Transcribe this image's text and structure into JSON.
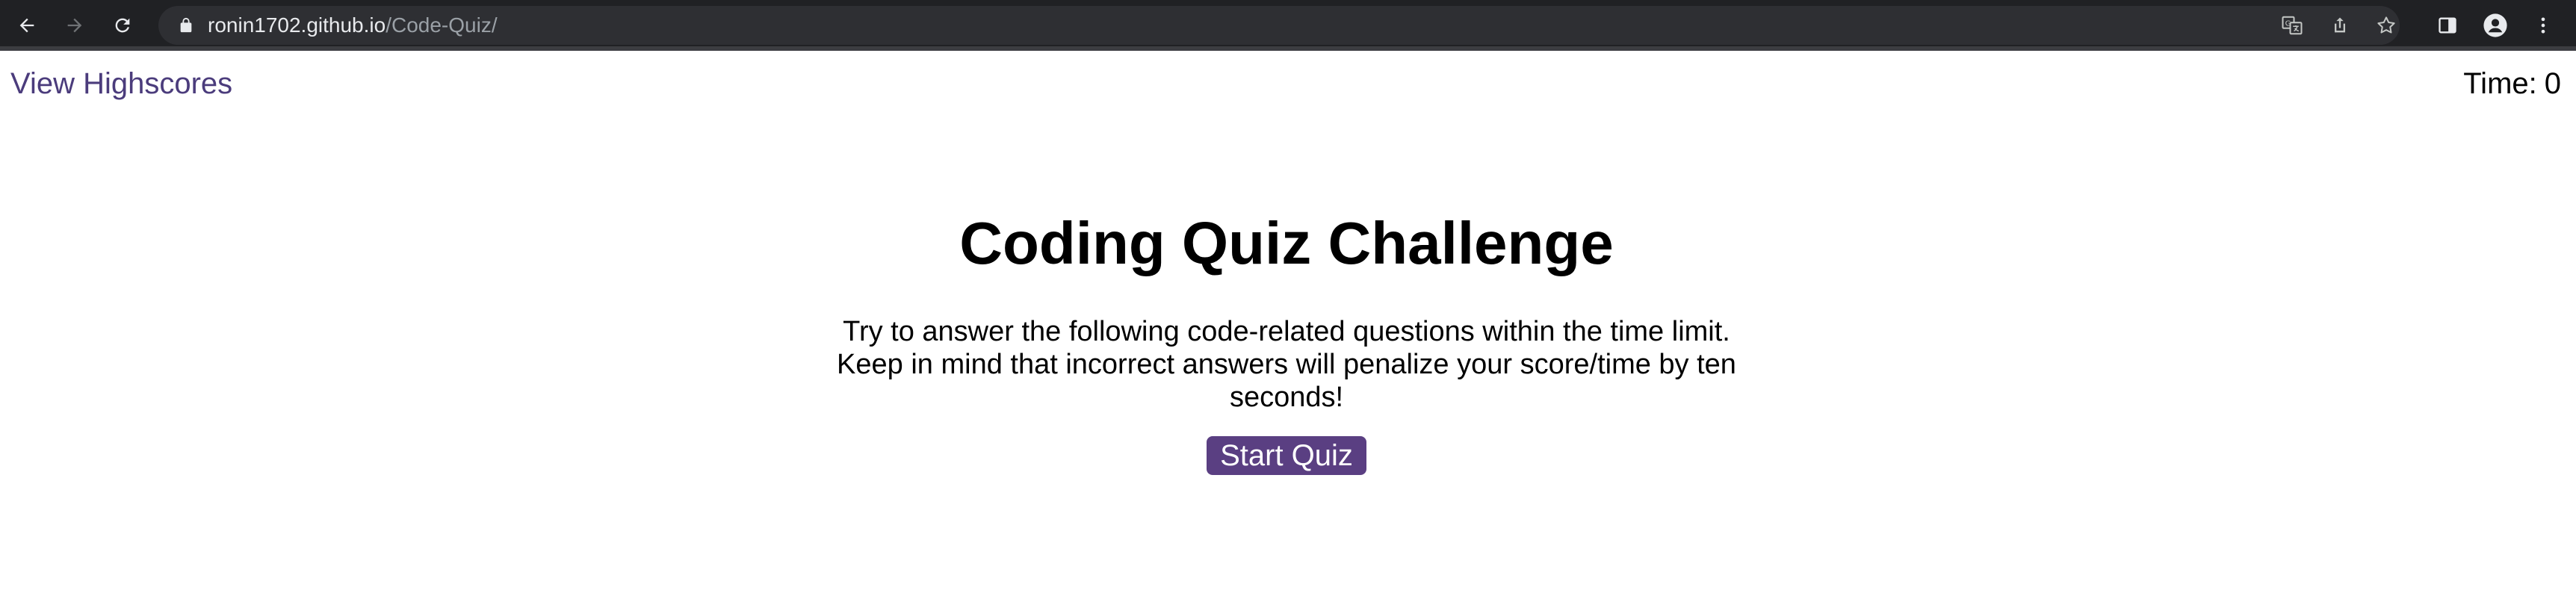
{
  "browser": {
    "url_host": "ronin1702.github.io",
    "url_path": "/Code-Quiz/",
    "icons": [
      "back-arrow-icon",
      "forward-arrow-icon",
      "reload-icon",
      "lock-icon",
      "translate-icon",
      "share-icon",
      "star-bookmark-icon",
      "side-panel-icon",
      "profile-icon",
      "more-menu-icon"
    ]
  },
  "header": {
    "highscores_label": "View Highscores",
    "timer_label": "Time:",
    "timer_value": "0"
  },
  "main": {
    "title": "Coding Quiz Challenge",
    "description": "Try to answer the following code-related questions within the time limit. Keep in mind that incorrect answers will penalize your score/time by ten seconds!",
    "start_label": "Start Quiz"
  },
  "colors": {
    "accent": "#5a3f82",
    "link": "#4b3c7c",
    "toolbar_bg": "#202124"
  }
}
